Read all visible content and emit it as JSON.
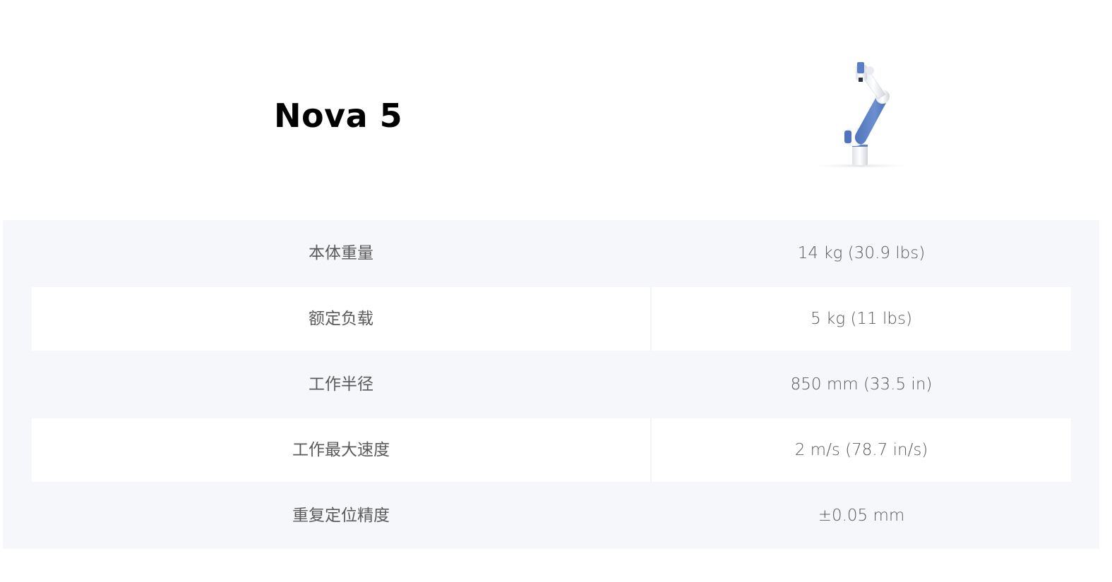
{
  "product": {
    "title": "Nova 5",
    "image_icon": "robot-arm-image"
  },
  "specs": [
    {
      "label": "本体重量",
      "value": "14 kg (30.9 lbs)"
    },
    {
      "label": "额定负载",
      "value": "5 kg (11 lbs)"
    },
    {
      "label": "工作半径",
      "value": "850 mm (33.5 in)"
    },
    {
      "label": "工作最大速度",
      "value": "2 m/s (78.7 in/s)"
    },
    {
      "label": "重复定位精度",
      "value": "±0.05 mm"
    }
  ],
  "colors": {
    "table_bg": "#f6f7fa",
    "row_alt_bg": "#ffffff",
    "text": "#5a5a5a",
    "arm_blue": "#5b7fc4",
    "arm_white": "#eef0f3"
  }
}
